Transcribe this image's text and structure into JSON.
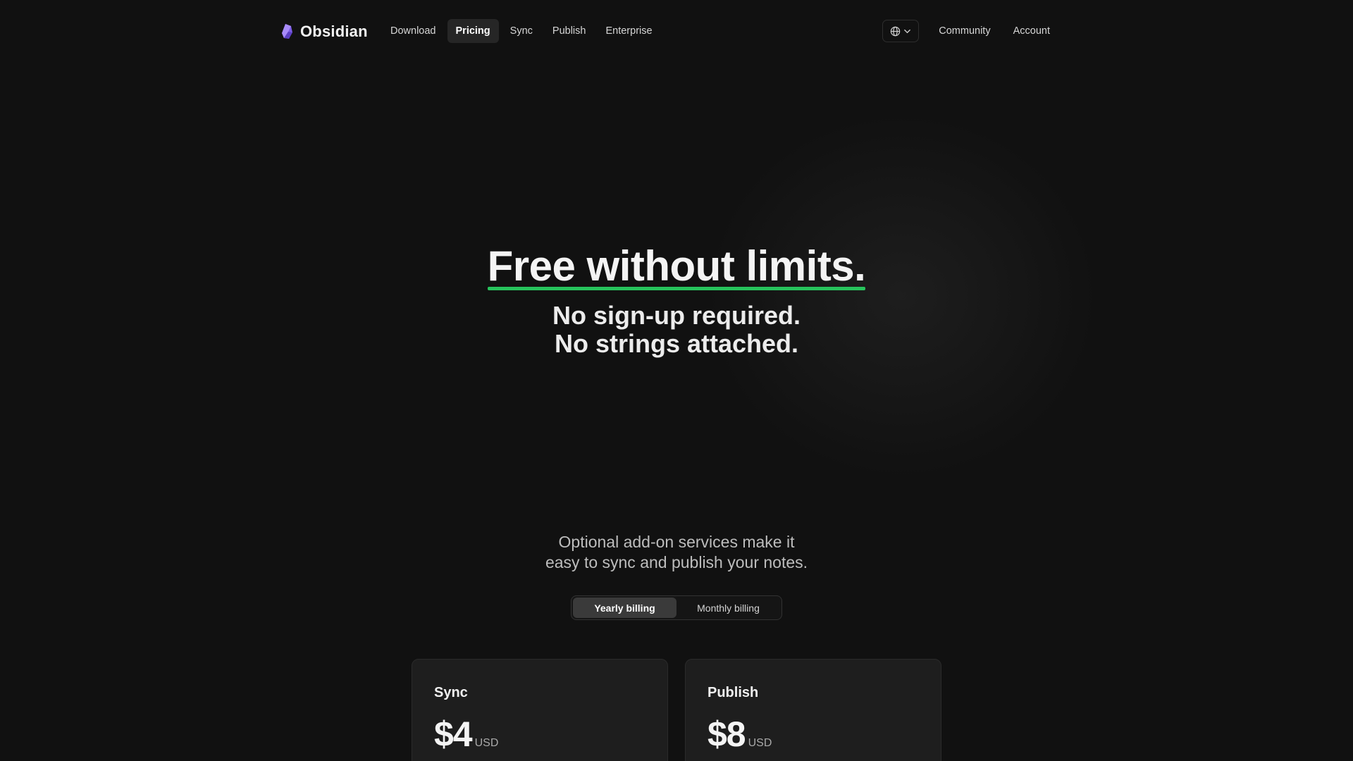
{
  "header": {
    "brand": "Obsidian",
    "brand_color": "#8b6cef",
    "nav": [
      {
        "label": "Download",
        "active": false
      },
      {
        "label": "Pricing",
        "active": true
      },
      {
        "label": "Sync",
        "active": false
      },
      {
        "label": "Publish",
        "active": false
      },
      {
        "label": "Enterprise",
        "active": false
      }
    ],
    "language_icon": "globe-icon",
    "right_links": [
      "Community",
      "Account"
    ]
  },
  "hero": {
    "title": "Free without limits.",
    "subtitle_line1": "No sign-up required.",
    "subtitle_line2": "No strings attached.",
    "accent": "#27c35c"
  },
  "addons": {
    "intro_line1": "Optional add-on services make it",
    "intro_line2": "easy to sync and publish your notes.",
    "billing_options": [
      {
        "label": "Yearly billing",
        "active": true
      },
      {
        "label": "Monthly billing",
        "active": false
      }
    ],
    "plans": [
      {
        "name": "Sync",
        "price": "$4",
        "currency": "USD"
      },
      {
        "name": "Publish",
        "price": "$8",
        "currency": "USD"
      }
    ]
  }
}
